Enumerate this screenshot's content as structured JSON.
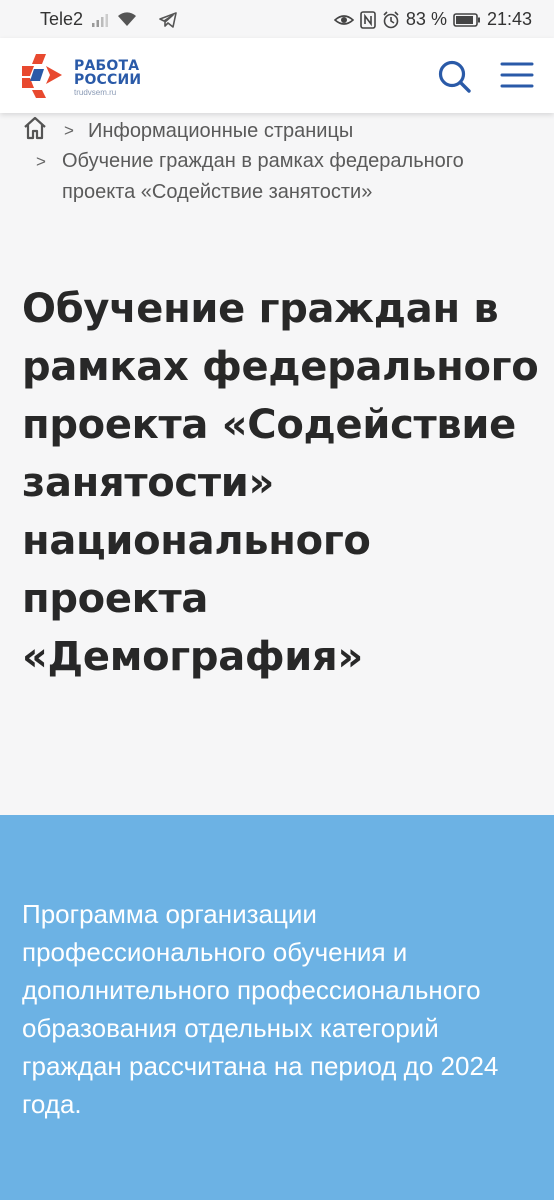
{
  "status_bar": {
    "carrier": "Tele2",
    "battery": "83 %",
    "time": "21:43"
  },
  "header": {
    "logo_line1": "РАБОТА",
    "logo_line2": "РОССИИ",
    "logo_url": "trudvsem.ru",
    "brand_colors": {
      "primary": "#2a5aa8",
      "accent": "#e8492f"
    }
  },
  "breadcrumbs": {
    "separator": ">",
    "items": [
      {
        "label": "Информационные страницы"
      },
      {
        "label": "Обучение граждан в рамках федерального проекта «Содействие занятости»"
      }
    ]
  },
  "page": {
    "title": "Обучение граждан в рамках федерального проекта «Содействие занятости» национального проекта «Демография»"
  },
  "info": {
    "background": "#6cb2e4",
    "text": "Программа организации профессионального обучения и дополнительного профессионального образования отдельных категорий граждан рассчитана на период до 2024 года."
  }
}
